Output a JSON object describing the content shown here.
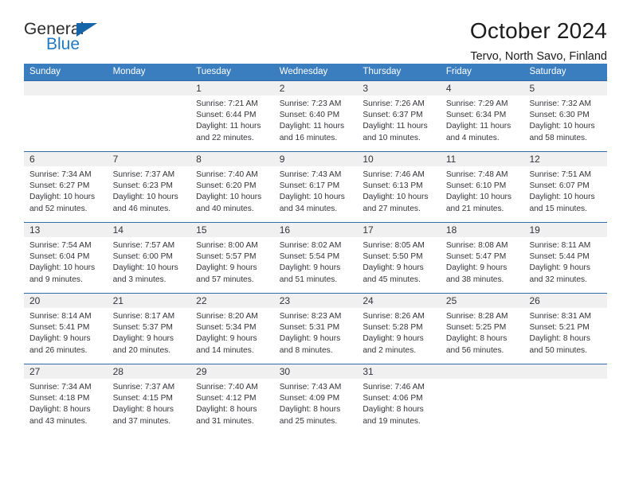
{
  "brand": {
    "name_part1": "General",
    "name_part2": "Blue",
    "accent_color": "#1f7ac4",
    "triangle_color": "#1565a8"
  },
  "header": {
    "title": "October 2024",
    "subtitle": "Tervo, North Savo, Finland"
  },
  "calendar": {
    "header_bg": "#3a7ec0",
    "row_separator_color": "#2f6ca8",
    "day_band_bg": "#f0f0f0",
    "weekdays": [
      "Sunday",
      "Monday",
      "Tuesday",
      "Wednesday",
      "Thursday",
      "Friday",
      "Saturday"
    ],
    "weeks": [
      [
        {
          "day": "",
          "lines": []
        },
        {
          "day": "",
          "lines": []
        },
        {
          "day": "1",
          "lines": [
            "Sunrise: 7:21 AM",
            "Sunset: 6:44 PM",
            "Daylight: 11 hours",
            "and 22 minutes."
          ]
        },
        {
          "day": "2",
          "lines": [
            "Sunrise: 7:23 AM",
            "Sunset: 6:40 PM",
            "Daylight: 11 hours",
            "and 16 minutes."
          ]
        },
        {
          "day": "3",
          "lines": [
            "Sunrise: 7:26 AM",
            "Sunset: 6:37 PM",
            "Daylight: 11 hours",
            "and 10 minutes."
          ]
        },
        {
          "day": "4",
          "lines": [
            "Sunrise: 7:29 AM",
            "Sunset: 6:34 PM",
            "Daylight: 11 hours",
            "and 4 minutes."
          ]
        },
        {
          "day": "5",
          "lines": [
            "Sunrise: 7:32 AM",
            "Sunset: 6:30 PM",
            "Daylight: 10 hours",
            "and 58 minutes."
          ]
        }
      ],
      [
        {
          "day": "6",
          "lines": [
            "Sunrise: 7:34 AM",
            "Sunset: 6:27 PM",
            "Daylight: 10 hours",
            "and 52 minutes."
          ]
        },
        {
          "day": "7",
          "lines": [
            "Sunrise: 7:37 AM",
            "Sunset: 6:23 PM",
            "Daylight: 10 hours",
            "and 46 minutes."
          ]
        },
        {
          "day": "8",
          "lines": [
            "Sunrise: 7:40 AM",
            "Sunset: 6:20 PM",
            "Daylight: 10 hours",
            "and 40 minutes."
          ]
        },
        {
          "day": "9",
          "lines": [
            "Sunrise: 7:43 AM",
            "Sunset: 6:17 PM",
            "Daylight: 10 hours",
            "and 34 minutes."
          ]
        },
        {
          "day": "10",
          "lines": [
            "Sunrise: 7:46 AM",
            "Sunset: 6:13 PM",
            "Daylight: 10 hours",
            "and 27 minutes."
          ]
        },
        {
          "day": "11",
          "lines": [
            "Sunrise: 7:48 AM",
            "Sunset: 6:10 PM",
            "Daylight: 10 hours",
            "and 21 minutes."
          ]
        },
        {
          "day": "12",
          "lines": [
            "Sunrise: 7:51 AM",
            "Sunset: 6:07 PM",
            "Daylight: 10 hours",
            "and 15 minutes."
          ]
        }
      ],
      [
        {
          "day": "13",
          "lines": [
            "Sunrise: 7:54 AM",
            "Sunset: 6:04 PM",
            "Daylight: 10 hours",
            "and 9 minutes."
          ]
        },
        {
          "day": "14",
          "lines": [
            "Sunrise: 7:57 AM",
            "Sunset: 6:00 PM",
            "Daylight: 10 hours",
            "and 3 minutes."
          ]
        },
        {
          "day": "15",
          "lines": [
            "Sunrise: 8:00 AM",
            "Sunset: 5:57 PM",
            "Daylight: 9 hours",
            "and 57 minutes."
          ]
        },
        {
          "day": "16",
          "lines": [
            "Sunrise: 8:02 AM",
            "Sunset: 5:54 PM",
            "Daylight: 9 hours",
            "and 51 minutes."
          ]
        },
        {
          "day": "17",
          "lines": [
            "Sunrise: 8:05 AM",
            "Sunset: 5:50 PM",
            "Daylight: 9 hours",
            "and 45 minutes."
          ]
        },
        {
          "day": "18",
          "lines": [
            "Sunrise: 8:08 AM",
            "Sunset: 5:47 PM",
            "Daylight: 9 hours",
            "and 38 minutes."
          ]
        },
        {
          "day": "19",
          "lines": [
            "Sunrise: 8:11 AM",
            "Sunset: 5:44 PM",
            "Daylight: 9 hours",
            "and 32 minutes."
          ]
        }
      ],
      [
        {
          "day": "20",
          "lines": [
            "Sunrise: 8:14 AM",
            "Sunset: 5:41 PM",
            "Daylight: 9 hours",
            "and 26 minutes."
          ]
        },
        {
          "day": "21",
          "lines": [
            "Sunrise: 8:17 AM",
            "Sunset: 5:37 PM",
            "Daylight: 9 hours",
            "and 20 minutes."
          ]
        },
        {
          "day": "22",
          "lines": [
            "Sunrise: 8:20 AM",
            "Sunset: 5:34 PM",
            "Daylight: 9 hours",
            "and 14 minutes."
          ]
        },
        {
          "day": "23",
          "lines": [
            "Sunrise: 8:23 AM",
            "Sunset: 5:31 PM",
            "Daylight: 9 hours",
            "and 8 minutes."
          ]
        },
        {
          "day": "24",
          "lines": [
            "Sunrise: 8:26 AM",
            "Sunset: 5:28 PM",
            "Daylight: 9 hours",
            "and 2 minutes."
          ]
        },
        {
          "day": "25",
          "lines": [
            "Sunrise: 8:28 AM",
            "Sunset: 5:25 PM",
            "Daylight: 8 hours",
            "and 56 minutes."
          ]
        },
        {
          "day": "26",
          "lines": [
            "Sunrise: 8:31 AM",
            "Sunset: 5:21 PM",
            "Daylight: 8 hours",
            "and 50 minutes."
          ]
        }
      ],
      [
        {
          "day": "27",
          "lines": [
            "Sunrise: 7:34 AM",
            "Sunset: 4:18 PM",
            "Daylight: 8 hours",
            "and 43 minutes."
          ]
        },
        {
          "day": "28",
          "lines": [
            "Sunrise: 7:37 AM",
            "Sunset: 4:15 PM",
            "Daylight: 8 hours",
            "and 37 minutes."
          ]
        },
        {
          "day": "29",
          "lines": [
            "Sunrise: 7:40 AM",
            "Sunset: 4:12 PM",
            "Daylight: 8 hours",
            "and 31 minutes."
          ]
        },
        {
          "day": "30",
          "lines": [
            "Sunrise: 7:43 AM",
            "Sunset: 4:09 PM",
            "Daylight: 8 hours",
            "and 25 minutes."
          ]
        },
        {
          "day": "31",
          "lines": [
            "Sunrise: 7:46 AM",
            "Sunset: 4:06 PM",
            "Daylight: 8 hours",
            "and 19 minutes."
          ]
        },
        {
          "day": "",
          "lines": []
        },
        {
          "day": "",
          "lines": []
        }
      ]
    ]
  }
}
